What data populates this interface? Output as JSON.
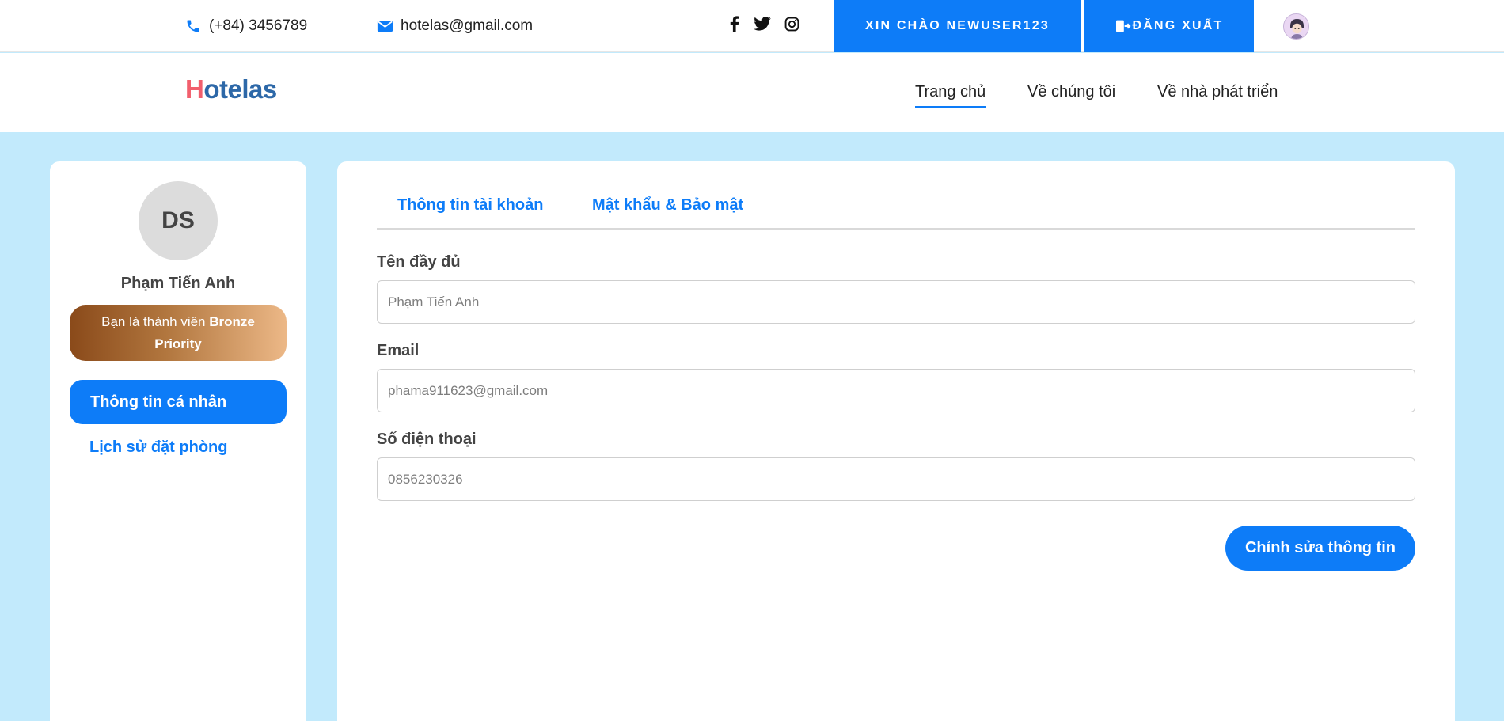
{
  "topbar": {
    "phone": "(+84) 3456789",
    "email": "hotelas@gmail.com",
    "greeting": "XIN CHÀO NEWUSER123",
    "logout": "ĐĂNG XUẤT"
  },
  "brand": {
    "logo_first": "H",
    "logo_rest": "otelas"
  },
  "nav": {
    "items": [
      {
        "label": "Trang chủ"
      },
      {
        "label": "Về chúng tôi"
      },
      {
        "label": "Về nhà phát triển"
      }
    ]
  },
  "sidebar": {
    "initials": "DS",
    "name": "Phạm Tiến Anh",
    "tier_prefix": "Bạn là thành viên ",
    "tier_name": "Bronze",
    "tier_suffix": "Priority",
    "items": [
      {
        "label": "Thông tin cá nhân"
      },
      {
        "label": "Lịch sử đặt phòng"
      }
    ]
  },
  "main": {
    "tabs": [
      {
        "label": "Thông tin tài khoản"
      },
      {
        "label": "Mật khẩu & Bảo mật"
      }
    ],
    "fields": [
      {
        "label": "Tên đầy đủ",
        "placeholder": "Phạm Tiến Anh"
      },
      {
        "label": "Email",
        "placeholder": "phama911623@gmail.com"
      },
      {
        "label": "Số điện thoại",
        "placeholder": "0856230326"
      }
    ],
    "edit_button": "Chỉnh sửa thông tin"
  },
  "colors": {
    "accent": "#0d7cf8",
    "background": "#c2eafc",
    "logo_h": "#f25f6d",
    "logo_text": "#2d68a8"
  },
  "icons": [
    "phone-icon",
    "mail-icon",
    "facebook-icon",
    "twitter-icon",
    "instagram-icon",
    "logout-icon",
    "user-avatar-icon"
  ]
}
